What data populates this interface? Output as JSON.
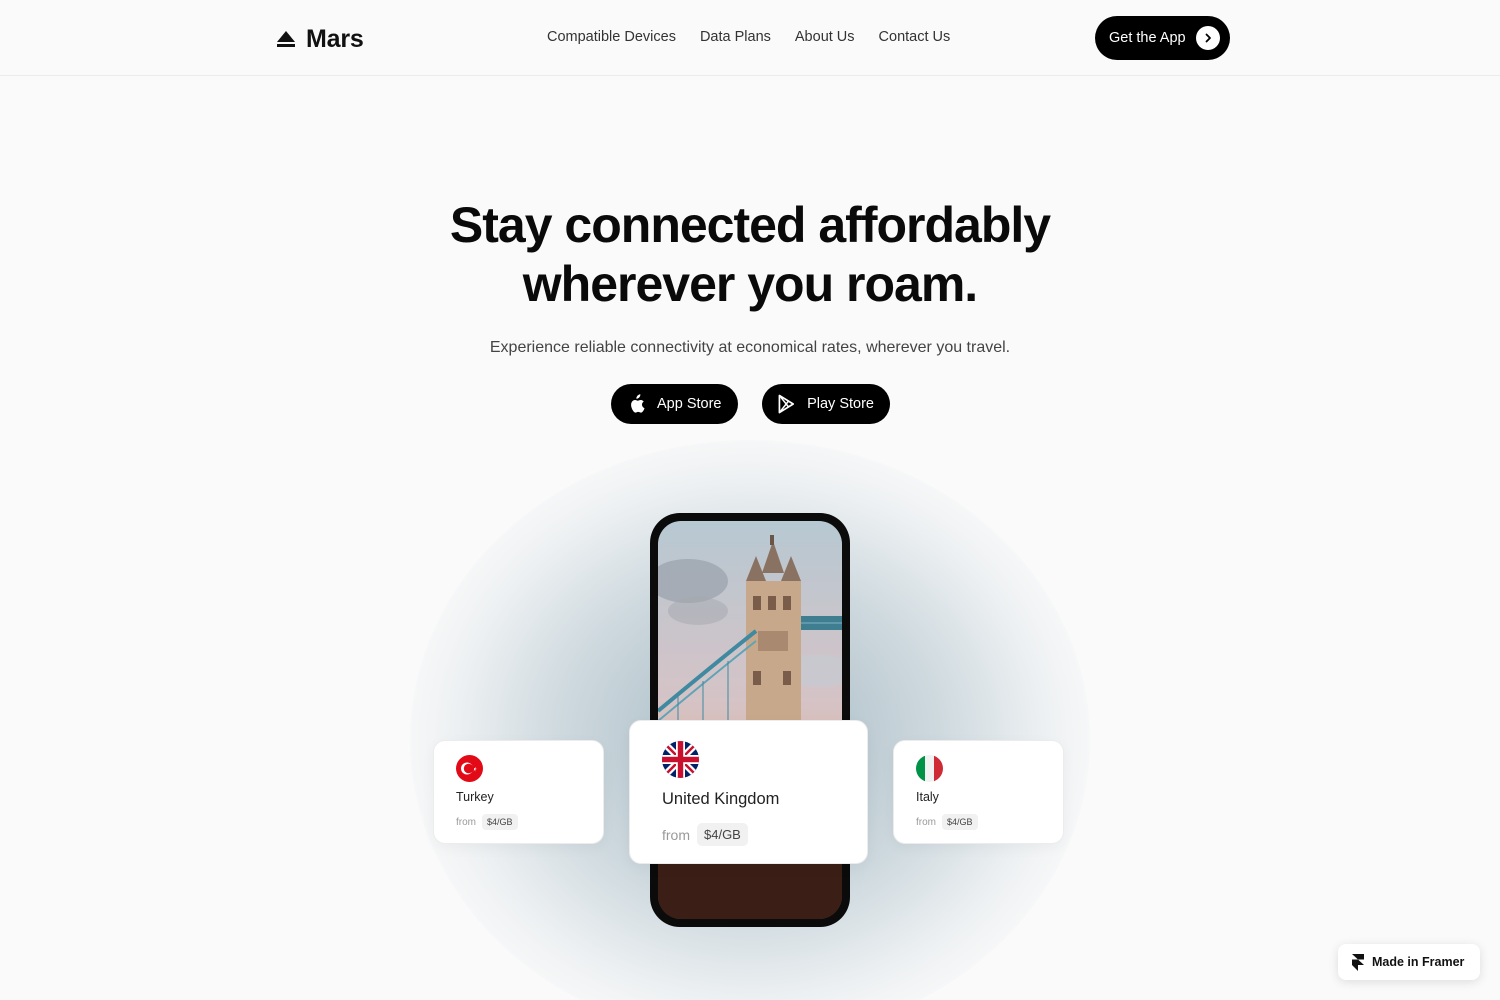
{
  "nav": {
    "logo_text": "Mars",
    "links": [
      "Compatible Devices",
      "Data Plans",
      "About Us",
      "Contact Us"
    ],
    "cta_label": "Get the App"
  },
  "hero": {
    "headline_line1": "Stay connected affordably",
    "headline_line2": "wherever you roam.",
    "subheadline": "Experience reliable connectivity at economical rates, wherever you travel.",
    "app_store_label": "App Store",
    "play_store_label": "Play Store"
  },
  "cards": {
    "left": {
      "country": "Turkey",
      "from_label": "from",
      "price": "$4/GB",
      "flag": "turkey-flag"
    },
    "center": {
      "country": "United Kingdom",
      "from_label": "from",
      "price": "$4/GB",
      "flag": "uk-flag"
    },
    "right": {
      "country": "Italy",
      "from_label": "from",
      "price": "$4/GB",
      "flag": "italy-flag"
    }
  },
  "badge": {
    "label": "Made in Framer"
  },
  "colors": {
    "background": "#fafafa",
    "primary": "#000000",
    "turkey_red": "#e30a17",
    "italy_green": "#009246",
    "italy_red": "#ce2b37",
    "uk_blue": "#012169",
    "uk_red": "#c8102e"
  }
}
